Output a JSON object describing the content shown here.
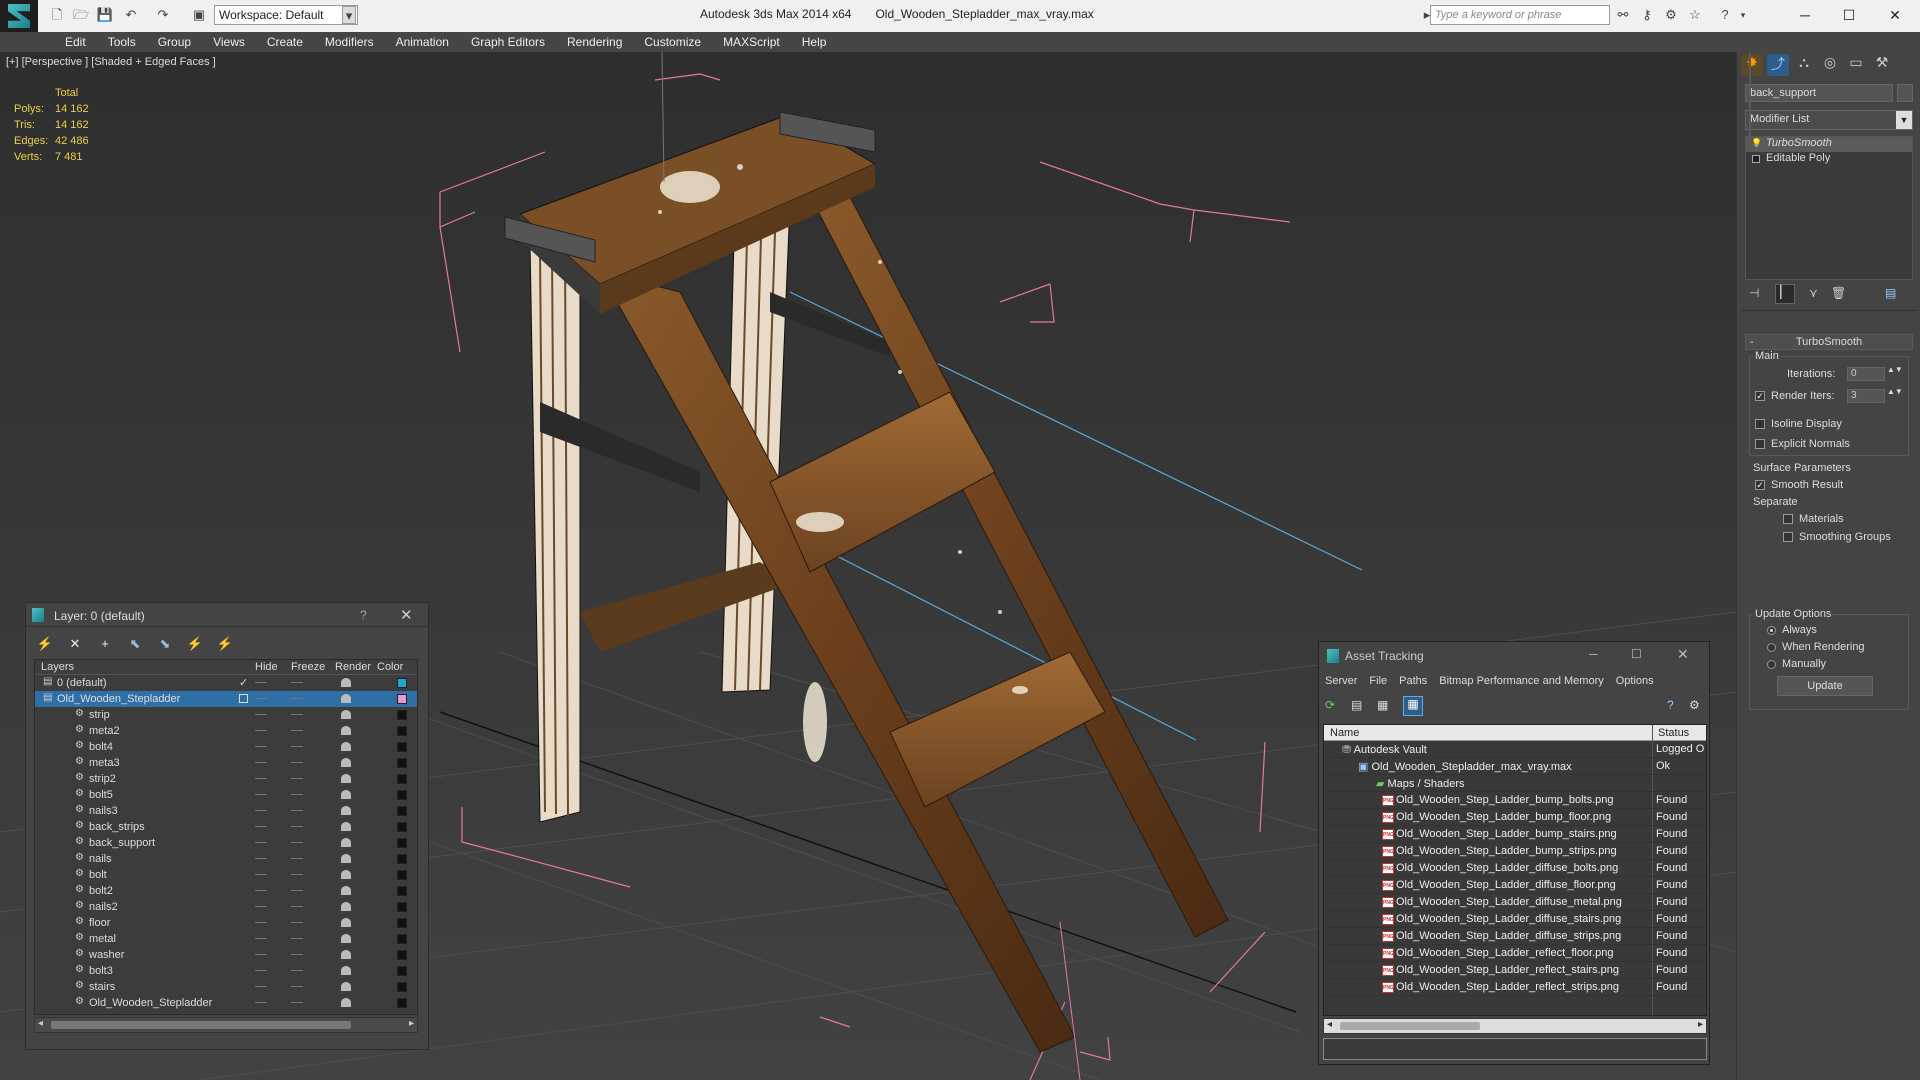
{
  "titlebar": {
    "app_title": "Autodesk 3ds Max  2014 x64",
    "file_title": "Old_Wooden_Stepladder_max_vray.max",
    "workspace": "Workspace: Default",
    "search_placeholder": "Type a keyword or phrase"
  },
  "menu": [
    "Edit",
    "Tools",
    "Group",
    "Views",
    "Create",
    "Modifiers",
    "Animation",
    "Graph Editors",
    "Rendering",
    "Customize",
    "MAXScript",
    "Help"
  ],
  "viewport": {
    "label": "[+] [Perspective ] [Shaded + Edged Faces ]",
    "stats": {
      "header": "Total",
      "polys_label": "Polys:",
      "polys": "14 162",
      "tris_label": "Tris:",
      "tris": "14 162",
      "edges_label": "Edges:",
      "edges": "42 486",
      "verts_label": "Verts:",
      "verts": "7 481"
    }
  },
  "command_panel": {
    "object_name": "back_support",
    "modifier_list": "Modifier List",
    "stack": [
      "TurboSmooth",
      "Editable Poly"
    ],
    "rollout_title": "TurboSmooth",
    "main_label": "Main",
    "iterations_label": "Iterations:",
    "iterations_value": "0",
    "render_iters_label": "Render Iters:",
    "render_iters_value": "3",
    "isoline_label": "Isoline Display",
    "explicit_normals_label": "Explicit Normals",
    "surface_params_label": "Surface Parameters",
    "smooth_result_label": "Smooth Result",
    "separate_label": "Separate",
    "materials_label": "Materials",
    "smoothing_groups_label": "Smoothing Groups",
    "update_options_label": "Update Options",
    "always_label": "Always",
    "when_rendering_label": "When Rendering",
    "manually_label": "Manually",
    "update_button": "Update"
  },
  "layer_dialog": {
    "title": "Layer: 0 (default)",
    "help": "?",
    "columns": {
      "layers": "Layers",
      "hide": "Hide",
      "freeze": "Freeze",
      "render": "Render",
      "color": "Color"
    },
    "rows": [
      {
        "name": "0 (default)",
        "level": 0,
        "color": "#1fa8c9",
        "check": true
      },
      {
        "name": "Old_Wooden_Stepladder",
        "level": 0,
        "color": "#e59ad3",
        "selected": true
      },
      {
        "name": "strip",
        "level": 1,
        "color": "#111111"
      },
      {
        "name": "meta2",
        "level": 1,
        "color": "#111111"
      },
      {
        "name": "bolt4",
        "level": 1,
        "color": "#111111"
      },
      {
        "name": "meta3",
        "level": 1,
        "color": "#111111"
      },
      {
        "name": "strip2",
        "level": 1,
        "color": "#111111"
      },
      {
        "name": "bolt5",
        "level": 1,
        "color": "#111111"
      },
      {
        "name": "nails3",
        "level": 1,
        "color": "#111111"
      },
      {
        "name": "back_strips",
        "level": 1,
        "color": "#111111"
      },
      {
        "name": "back_support",
        "level": 1,
        "color": "#111111"
      },
      {
        "name": "nails",
        "level": 1,
        "color": "#111111"
      },
      {
        "name": "bolt",
        "level": 1,
        "color": "#111111"
      },
      {
        "name": "bolt2",
        "level": 1,
        "color": "#111111"
      },
      {
        "name": "nails2",
        "level": 1,
        "color": "#111111"
      },
      {
        "name": "floor",
        "level": 1,
        "color": "#111111"
      },
      {
        "name": "metal",
        "level": 1,
        "color": "#111111"
      },
      {
        "name": "washer",
        "level": 1,
        "color": "#111111"
      },
      {
        "name": "bolt3",
        "level": 1,
        "color": "#111111"
      },
      {
        "name": "stairs",
        "level": 1,
        "color": "#111111"
      },
      {
        "name": "Old_Wooden_Stepladder",
        "level": 1,
        "color": "#111111"
      }
    ]
  },
  "asset_tracking": {
    "title": "Asset Tracking",
    "menu": [
      "Server",
      "File",
      "Paths",
      "Bitmap Performance and Memory",
      "Options"
    ],
    "columns": {
      "name": "Name",
      "status": "Status"
    },
    "vault": {
      "name": "Autodesk Vault",
      "status": "Logged O"
    },
    "file": {
      "name": "Old_Wooden_Stepladder_max_vray.max",
      "status": "Ok"
    },
    "folder": {
      "name": "Maps / Shaders"
    },
    "maps": [
      {
        "name": "Old_Wooden_Step_Ladder_bump_bolts.png",
        "status": "Found"
      },
      {
        "name": "Old_Wooden_Step_Ladder_bump_floor.png",
        "status": "Found"
      },
      {
        "name": "Old_Wooden_Step_Ladder_bump_stairs.png",
        "status": "Found"
      },
      {
        "name": "Old_Wooden_Step_Ladder_bump_strips.png",
        "status": "Found"
      },
      {
        "name": "Old_Wooden_Step_Ladder_diffuse_bolts.png",
        "status": "Found"
      },
      {
        "name": "Old_Wooden_Step_Ladder_diffuse_floor.png",
        "status": "Found"
      },
      {
        "name": "Old_Wooden_Step_Ladder_diffuse_metal.png",
        "status": "Found"
      },
      {
        "name": "Old_Wooden_Step_Ladder_diffuse_stairs.png",
        "status": "Found"
      },
      {
        "name": "Old_Wooden_Step_Ladder_diffuse_strips.png",
        "status": "Found"
      },
      {
        "name": "Old_Wooden_Step_Ladder_reflect_floor.png",
        "status": "Found"
      },
      {
        "name": "Old_Wooden_Step_Ladder_reflect_stairs.png",
        "status": "Found"
      },
      {
        "name": "Old_Wooden_Step_Ladder_reflect_strips.png",
        "status": "Found"
      }
    ]
  }
}
